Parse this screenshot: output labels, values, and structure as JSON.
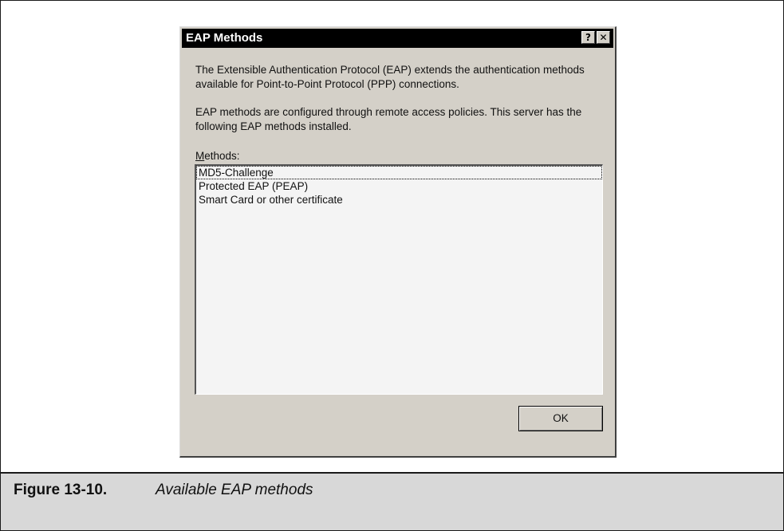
{
  "dialog": {
    "title": "EAP Methods",
    "help_button": "?",
    "close_button": "✕",
    "description_1": "The Extensible Authentication Protocol (EAP) extends the authentication methods available for Point-to-Point Protocol (PPP) connections.",
    "description_2": "EAP methods are configured through remote access policies. This server has the following EAP methods installed.",
    "methods_label_mnemonic": "M",
    "methods_label_rest": "ethods:",
    "methods": [
      "MD5-Challenge",
      "Protected EAP (PEAP)",
      "Smart Card or other certificate"
    ],
    "ok_label": "OK"
  },
  "figure": {
    "label": "Figure 13-10.",
    "caption": "Available EAP methods"
  }
}
